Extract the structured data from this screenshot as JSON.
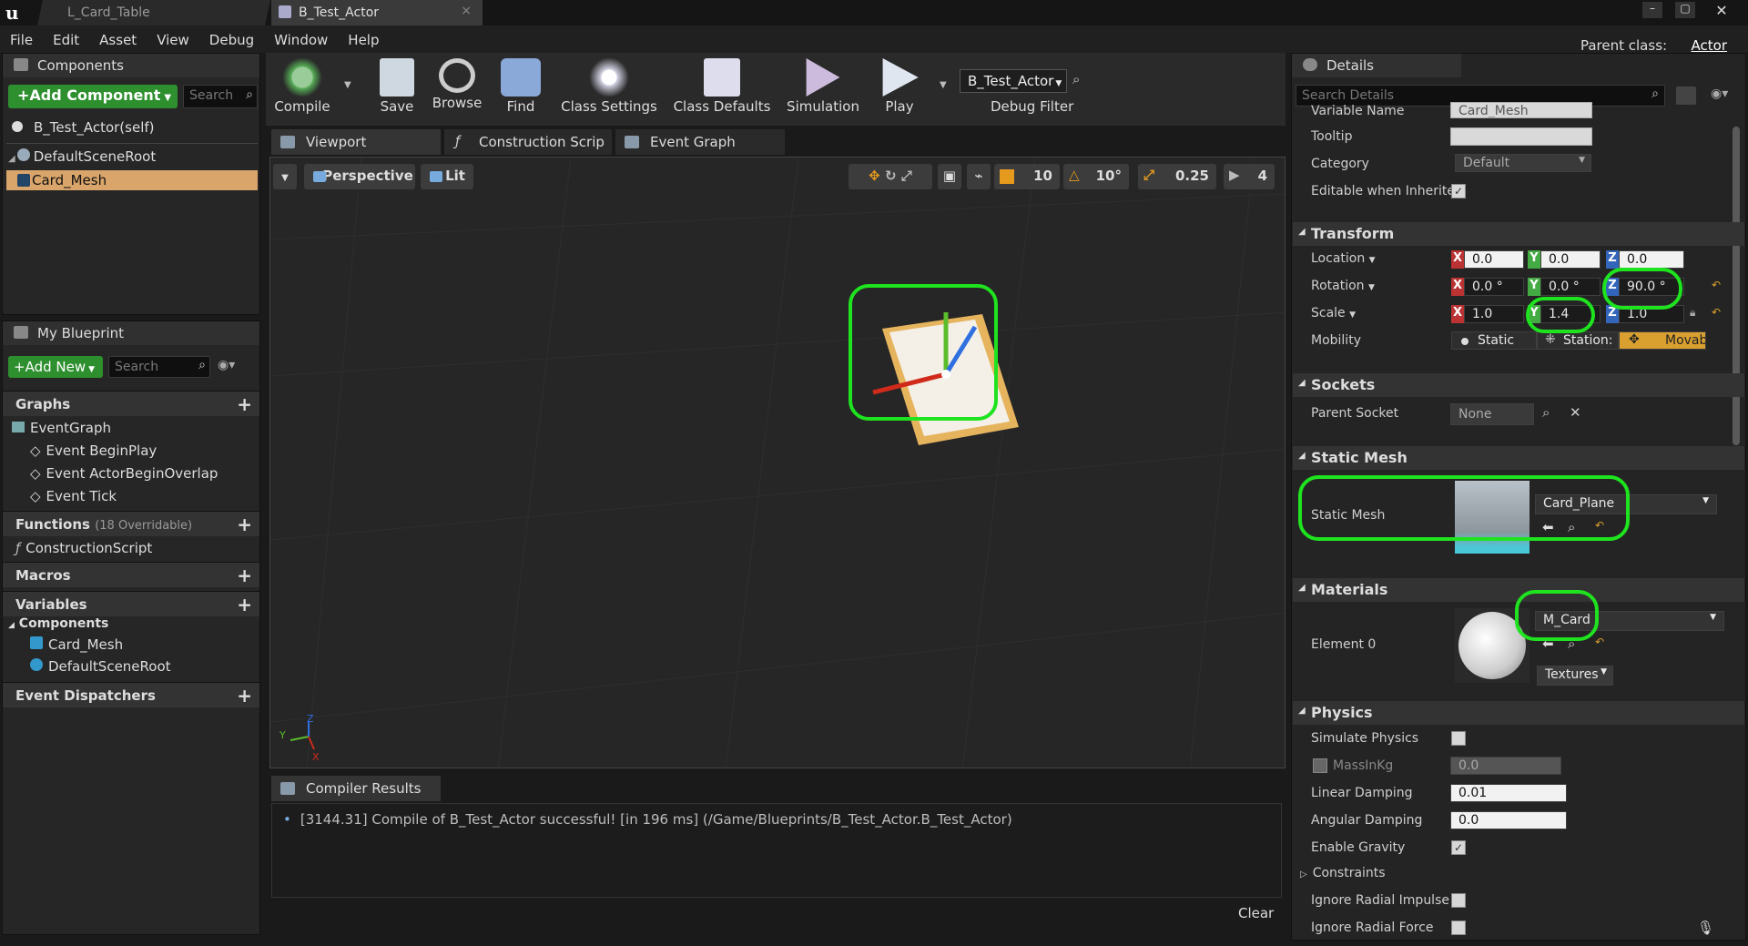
{
  "title_bar": {
    "tabs": [
      "L_Card_Table",
      "B_Test_Actor"
    ],
    "parent_class_label": "Parent class:",
    "parent_class_value": "Actor"
  },
  "menu": [
    "File",
    "Edit",
    "Asset",
    "View",
    "Debug",
    "Window",
    "Help"
  ],
  "components_panel": {
    "title": "Components",
    "add_component": "+Add Component",
    "search_placeholder": "Search",
    "self_item": "B_Test_Actor(self)",
    "root": "DefaultSceneRoot",
    "selected": "Card_Mesh"
  },
  "my_blueprint": {
    "title": "My Blueprint",
    "add_new": "+Add New",
    "search_placeholder": "Search",
    "graphs_label": "Graphs",
    "event_graph": "EventGraph",
    "events": [
      "Event BeginPlay",
      "Event ActorBeginOverlap",
      "Event Tick"
    ],
    "functions_label": "Functions",
    "functions_count": "(18 Overridable)",
    "construction_script": "ConstructionScript",
    "macros_label": "Macros",
    "variables_label": "Variables",
    "components_label": "Components",
    "var_components": [
      "Card_Mesh",
      "DefaultSceneRoot"
    ],
    "dispatchers_label": "Event Dispatchers"
  },
  "toolbar": {
    "compile": "Compile",
    "save": "Save",
    "browse": "Browse",
    "find": "Find",
    "class_settings": "Class Settings",
    "class_defaults": "Class Defaults",
    "simulation": "Simulation",
    "play": "Play",
    "debug_object": "B_Test_Actor",
    "debug_filter": "Debug Filter"
  },
  "editor_tabs": [
    "Viewport",
    "Construction Scrip",
    "Event Graph"
  ],
  "viewport": {
    "perspective": "Perspective",
    "lit": "Lit",
    "grid_snap": "10",
    "rot_snap": "10°",
    "scale_snap": "0.25",
    "cam_speed": "4",
    "axis_y": "Y",
    "axis_z": "Z",
    "axis_x": "X"
  },
  "compiler": {
    "tab": "Compiler Results",
    "message": "[3144.31] Compile of B_Test_Actor successful! [in 196 ms] (/Game/Blueprints/B_Test_Actor.B_Test_Actor)",
    "clear": "Clear"
  },
  "details": {
    "title": "Details",
    "search_placeholder": "Search Details",
    "variable_name_label": "Variable Name",
    "variable_name_value": "Card_Mesh",
    "tooltip_label": "Tooltip",
    "category_label": "Category",
    "category_value": "Default",
    "editable_label": "Editable when Inherite",
    "transform": "Transform",
    "location_label": "Location",
    "location": [
      "0.0",
      "0.0",
      "0.0"
    ],
    "rotation_label": "Rotation",
    "rotation": [
      "0.0 °",
      "0.0 °",
      "90.0 °"
    ],
    "scale_label": "Scale",
    "scale": [
      "1.0",
      "1.4",
      "1.0"
    ],
    "mobility_label": "Mobility",
    "mobility": [
      "Static",
      "Station:",
      "Movabl"
    ],
    "sockets": "Sockets",
    "parent_socket_label": "Parent Socket",
    "parent_socket_value": "None",
    "static_mesh_section": "Static Mesh",
    "static_mesh_label": "Static Mesh",
    "static_mesh_value": "Card_Plane",
    "materials": "Materials",
    "element0_label": "Element 0",
    "material_value": "M_Card",
    "textures": "Textures",
    "physics": "Physics",
    "simulate_physics": "Simulate Physics",
    "mass_label": "MassInKg",
    "mass_value": "0.0",
    "linear_damping_label": "Linear Damping",
    "linear_damping": "0.01",
    "angular_damping_label": "Angular Damping",
    "angular_damping": "0.0",
    "enable_gravity": "Enable Gravity",
    "constraints": "Constraints",
    "ignore_radial_impulse": "Ignore Radial Impulse",
    "ignore_radial_force": "Ignore Radial Force"
  },
  "colors": {
    "accent_green": "#1ee31e",
    "add_button": "#2e8f2e",
    "selection": "#d9a56a"
  }
}
